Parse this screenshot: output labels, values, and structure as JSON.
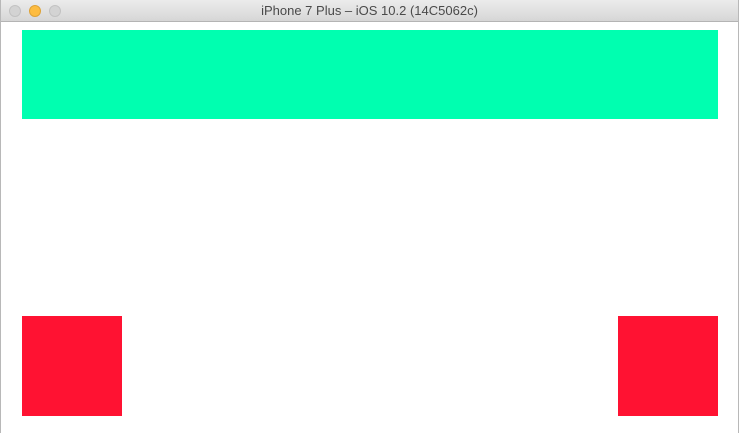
{
  "window": {
    "title": "iPhone 7 Plus – iOS 10.2 (14C5062c)"
  },
  "colors": {
    "banner": "#00ffb0",
    "square": "#ff1232",
    "background": "#ffffff"
  },
  "icons": {
    "close": "close-icon",
    "minimize": "minimize-icon",
    "zoom": "zoom-icon"
  }
}
